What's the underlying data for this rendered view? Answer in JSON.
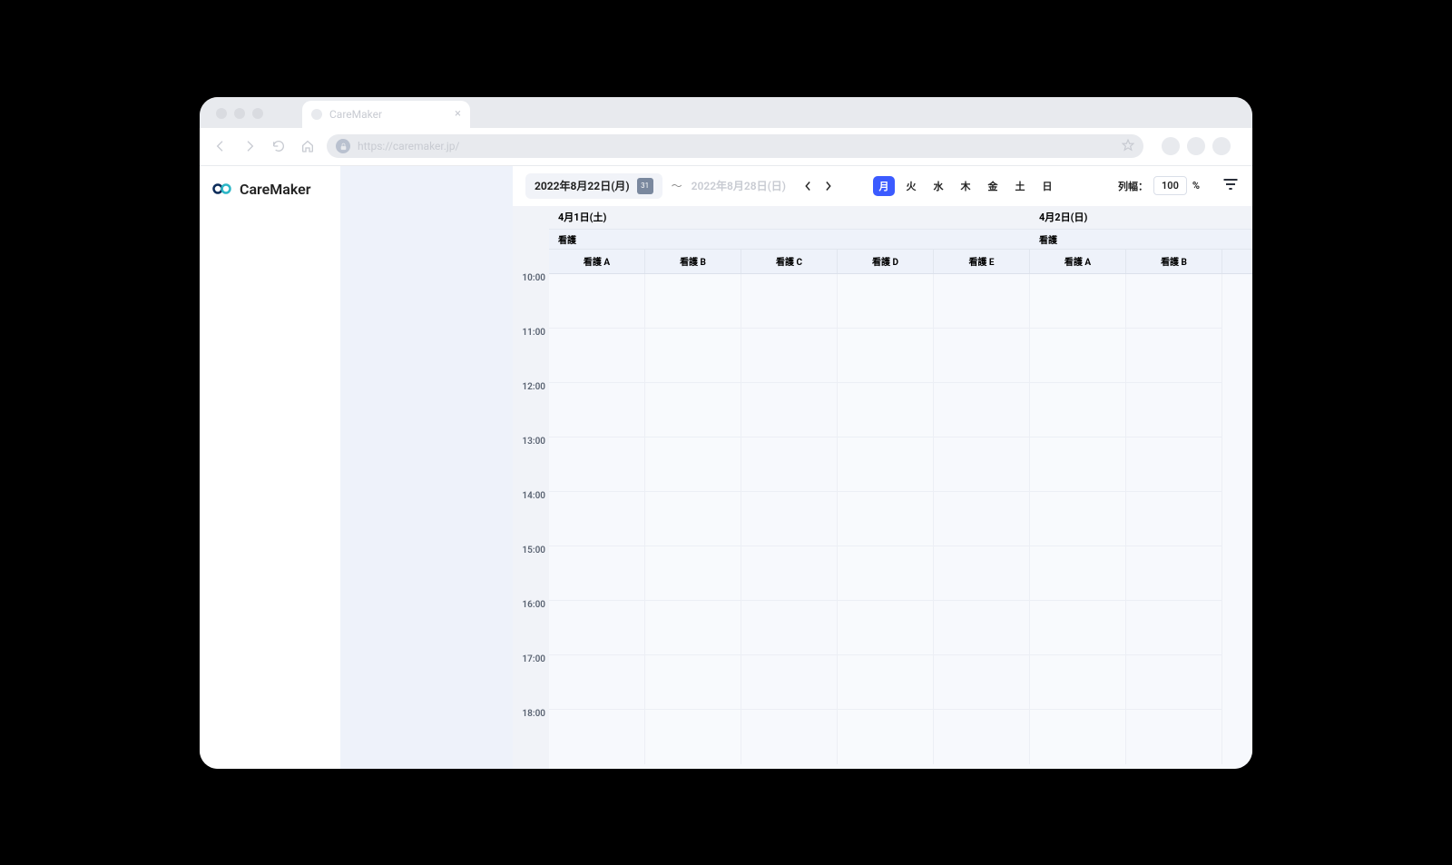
{
  "browser": {
    "tab_title": "CareMaker",
    "url": "https://caremaker.jp/"
  },
  "app": {
    "logo_text": "CareMaker"
  },
  "controls": {
    "date_start": "2022年8月22日(月)",
    "cal_icon_text": "31",
    "range_sep": "〜",
    "date_end": "2022年8月28日(日)",
    "days": [
      "月",
      "火",
      "水",
      "木",
      "金",
      "土",
      "日"
    ],
    "active_day_index": 0,
    "col_width_label": "列幅：",
    "col_width_value": "100",
    "col_width_unit": "%"
  },
  "schedule": {
    "time_slots": [
      "10:00",
      "11:00",
      "12:00",
      "13:00",
      "14:00",
      "15:00",
      "16:00",
      "17:00",
      "18:00"
    ],
    "days": [
      {
        "date": "4月1日(土)",
        "group": "看護",
        "staff": [
          "看護 A",
          "看護 B",
          "看護 C",
          "看護 D",
          "看護 E"
        ]
      },
      {
        "date": "4月2日(日)",
        "group": "看護",
        "staff": [
          "看護 A",
          "看護 B"
        ]
      }
    ]
  }
}
